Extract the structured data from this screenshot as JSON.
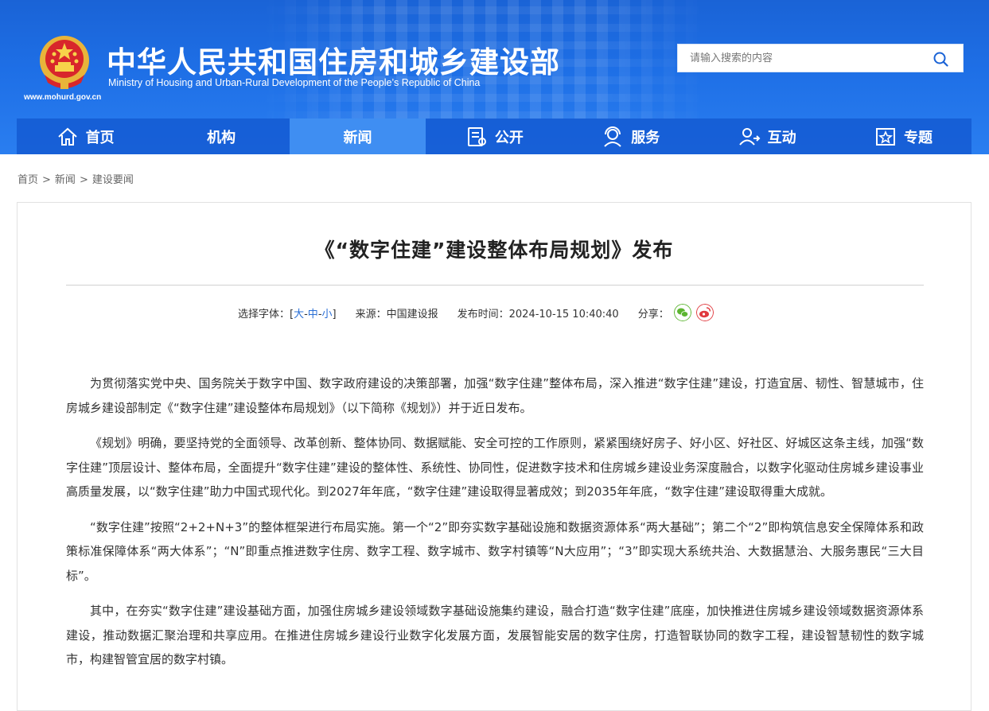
{
  "header": {
    "title_cn": "中华人民共和国住房和城乡建设部",
    "title_en": "Ministry of Housing and Urban-Rural Development of the People’s Republic of China",
    "site_url": "www.mohurd.gov.cn"
  },
  "search": {
    "placeholder": "请输入搜索的内容",
    "icon": "search-icon"
  },
  "nav": {
    "items": [
      {
        "label": "首页",
        "icon": "home-icon"
      },
      {
        "label": "机构"
      },
      {
        "label": "新闻",
        "active": true
      },
      {
        "label": "公开",
        "icon": "document-icon"
      },
      {
        "label": "服务",
        "icon": "service-icon"
      },
      {
        "label": "互动",
        "icon": "interaction-icon"
      },
      {
        "label": "专题",
        "icon": "star-box-icon"
      }
    ]
  },
  "breadcrumb": {
    "items": [
      "首页",
      "新闻",
      "建设要闻"
    ],
    "separator": ">"
  },
  "article": {
    "title": "《“数字住建”建设整体布局规划》发布",
    "meta": {
      "font_label": "选择字体：[",
      "font_large": "大",
      "font_medium": "中",
      "font_small": "小",
      "font_close": "]",
      "dash": "-",
      "source": "来源：中国建设报",
      "publish_time": "发布时间：2024-10-15 10:40:40",
      "share_label": "分享："
    },
    "paragraphs": [
      "为贯彻落实党中央、国务院关于数字中国、数字政府建设的决策部署，加强“数字住建”整体布局，深入推进“数字住建”建设，打造宜居、韧性、智慧城市，住房城乡建设部制定《“数字住建”建设整体布局规划》（以下简称《规划》）并于近日发布。",
      "《规划》明确，要坚持党的全面领导、改革创新、整体协同、数据赋能、安全可控的工作原则，紧紧围绕好房子、好小区、好社区、好城区这条主线，加强“数字住建”顶层设计、整体布局，全面提升“数字住建”建设的整体性、系统性、协同性，促进数字技术和住房城乡建设业务深度融合，以数字化驱动住房城乡建设事业高质量发展，以“数字住建”助力中国式现代化。到2027年年底，“数字住建”建设取得显著成效；到2035年年底，“数字住建”建设取得重大成就。",
      "“数字住建”按照“2+2+N+3”的整体框架进行布局实施。第一个“2”即夯实数字基础设施和数据资源体系“两大基础”；第二个“2”即构筑信息安全保障体系和政策标准保障体系“两大体系”；“N”即重点推进数字住房、数字工程、数字城市、数字村镇等“N大应用”；“3”即实现大系统共治、大数据慧治、大服务惠民“三大目标”。",
      "其中，在夯实“数字住建”建设基础方面，加强住房城乡建设领域数字基础设施集约建设，融合打造“数字住建”底座，加快推进住房城乡建设领域数据资源体系建设，推动数据汇聚治理和共享应用。在推进住房城乡建设行业数字化发展方面，发展智能安居的数字住房，打造智联协同的数字工程，建设智慧韧性的数字城市，构建智管宜居的数字村镇。"
    ]
  },
  "colors": {
    "header_blue": "#1e6fe6",
    "nav_active": "#3f8ef2",
    "link_blue": "#2a6fd6",
    "wechat_green": "#5cb531",
    "weibo_red": "#e0393e"
  }
}
